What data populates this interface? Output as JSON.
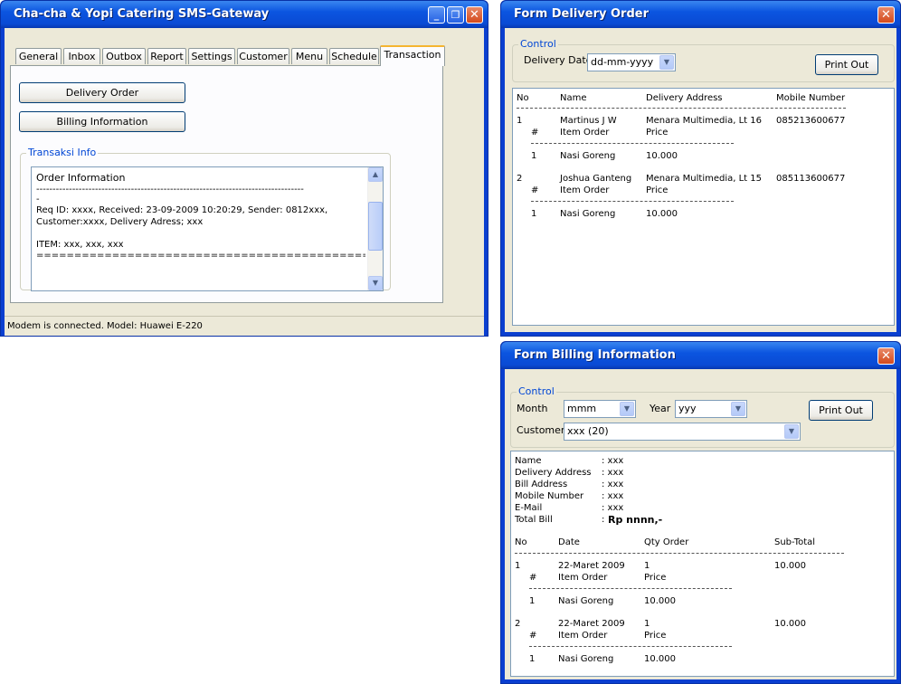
{
  "main": {
    "title": "Cha-cha & Yopi Catering  SMS-Gateway",
    "window_buttons": {
      "minimize": "_",
      "restore": "❐",
      "close": "✕"
    },
    "tabs": [
      "General",
      "Inbox",
      "Outbox",
      "Report",
      "Settings",
      "Customer",
      "Menu",
      "Schedule",
      "Transaction"
    ],
    "active_tab": "Transaction",
    "buttons": {
      "delivery_order": "Delivery Order",
      "billing_information": "Billing Information"
    },
    "info_group": "Transaksi Info",
    "memo": {
      "line1": "Order Information",
      "line2": "----------------------------------------------------------------------------------",
      "line3": "-",
      "line4": "Req ID: xxxx, Received: 23-09-2009 10:20:29, Sender: 0812xxx,",
      "line5": "Customer:xxxx, Delivery Adress; xxx",
      "line6": "ITEM: xxx, xxx, xxx",
      "line7": "=============================================="
    },
    "status": "Modem is connected. Model: Huawei E-220"
  },
  "delivery": {
    "title": "Form Delivery Order",
    "close": "✕",
    "group": "Control",
    "date_label": "Delivery Date",
    "date_value": "dd-mm-yyyy",
    "print_button": "Print Out",
    "headers": {
      "no": "No",
      "name": "Name",
      "address": "Delivery Address",
      "mobile": "Mobile Number"
    },
    "rows": [
      {
        "no": "1",
        "name": "Martinus J W",
        "address": "Menara Multimedia, Lt 16",
        "mobile": "085213600677",
        "item_hash": "#",
        "item_col": "Item Order",
        "price_col": "Price",
        "item_no": "1",
        "item_name": "Nasi Goreng",
        "item_price": "10.000"
      },
      {
        "no": "2",
        "name": "Joshua Ganteng",
        "address": "Menara Multimedia, Lt 15",
        "mobile": "085113600677",
        "item_hash": "#",
        "item_col": "Item Order",
        "price_col": "Price",
        "item_no": "1",
        "item_name": "Nasi Goreng",
        "item_price": "10.000"
      }
    ]
  },
  "billing": {
    "title": "Form Billing Information",
    "close": "✕",
    "group": "Control",
    "month_label": "Month",
    "month_value": "mmm",
    "year_label": "Year",
    "year_value": "yyy",
    "customer_label": "Customer",
    "customer_value": "xxx (20)",
    "print_button": "Print Out",
    "info_labels": {
      "name": "Name",
      "delivery": "Delivery Address",
      "bill": "Bill Address",
      "mobile": "Mobile Number",
      "email": "E-Mail",
      "total": "Total Bill"
    },
    "info_values": {
      "name": ": xxx",
      "delivery": ": xxx",
      "bill": ": xxx",
      "mobile": ": xxx",
      "email": ": xxx",
      "total_colon": ":",
      "total": "Rp nnnn,-"
    },
    "headers": {
      "no": "No",
      "date": "Date",
      "qty": "Qty Order",
      "subtotal": "Sub-Total"
    },
    "rows": [
      {
        "no": "1",
        "date": "22-Maret 2009",
        "qty": "1",
        "subtotal": "10.000",
        "item_hash": "#",
        "item_col": "Item Order",
        "price_col": "Price",
        "item_no": "1",
        "item_name": "Nasi Goreng",
        "item_price": "10.000"
      },
      {
        "no": "2",
        "date": "22-Maret 2009",
        "qty": "1",
        "subtotal": "10.000",
        "item_hash": "#",
        "item_col": "Item Order",
        "price_col": "Price",
        "item_no": "1",
        "item_name": "Nasi Goreng",
        "item_price": "10.000"
      }
    ]
  },
  "colors": {
    "titlebar": "#0a4ad4",
    "face": "#ece9d8",
    "group_label": "#0046d5",
    "tab_highlight": "#f5b531"
  }
}
